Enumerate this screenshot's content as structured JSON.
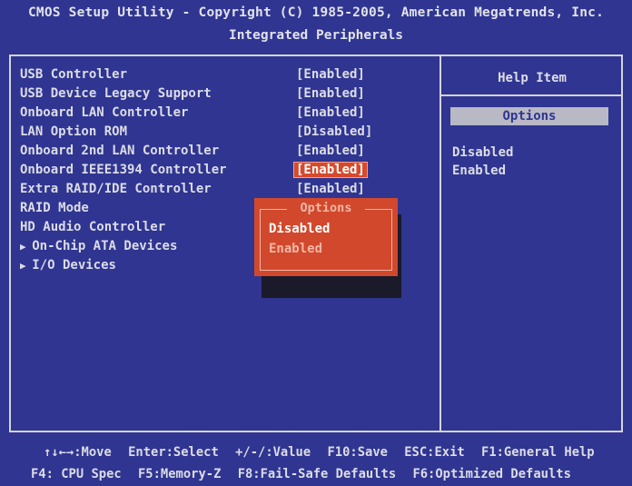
{
  "header": {
    "line1": "CMOS Setup Utility - Copyright (C) 1985-2005, American Megatrends, Inc.",
    "line2": "Integrated Peripherals"
  },
  "rows": [
    {
      "label": "USB Controller",
      "value": "[Enabled]"
    },
    {
      "label": "USB Device Legacy Support",
      "value": "[Enabled]"
    },
    {
      "label": "Onboard LAN Controller",
      "value": "[Enabled]"
    },
    {
      "label": "LAN Option ROM",
      "value": "[Disabled]"
    },
    {
      "label": "Onboard 2nd LAN Controller",
      "value": "[Enabled]"
    },
    {
      "label": "Onboard IEEE1394 Controller",
      "value": "[Enabled]"
    },
    {
      "label": "Extra RAID/IDE Controller",
      "value": "[Enabled]"
    },
    {
      "label": "RAID Mode",
      "value": ""
    },
    {
      "label": "HD Audio Controller",
      "value": ""
    },
    {
      "label": "On-Chip ATA Devices",
      "value": ""
    },
    {
      "label": "I/O Devices",
      "value": ""
    }
  ],
  "help": {
    "title": "Help Item",
    "options_header": "Options",
    "options": [
      "Disabled",
      "Enabled"
    ]
  },
  "popup": {
    "title": "Options",
    "options": [
      "Disabled",
      "Enabled"
    ]
  },
  "footer": {
    "line1": [
      ":Move",
      "Enter:Select",
      "+/-/:Value",
      "F10:Save",
      "ESC:Exit",
      "F1:General Help"
    ],
    "line2": [
      "F4: CPU Spec",
      "F5:Memory-Z",
      "F8:Fail-Safe Defaults",
      "F6:Optimized Defaults"
    ],
    "move_keys": "↑↓←→"
  },
  "colors": {
    "background": "#2f3591",
    "text": "#dcdce6",
    "highlight": "#d64a2c"
  }
}
